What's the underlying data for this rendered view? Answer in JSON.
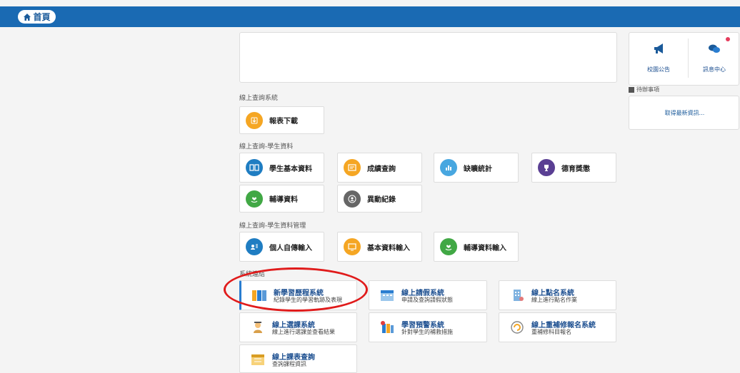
{
  "nav": {
    "home_label": "首頁"
  },
  "sections": {
    "query_system": "線上查詢系統",
    "student_data": "線上查詢-學生資料",
    "student_manage": "線上查詢-學生資料管理",
    "systems": "系統連結"
  },
  "query_items": [
    {
      "label": "報表下載",
      "icon": "download-icon"
    }
  ],
  "student_items": [
    {
      "label": "學生基本資料",
      "icon": "book-icon"
    },
    {
      "label": "成績查詢",
      "icon": "report-icon"
    },
    {
      "label": "缺曠統計",
      "icon": "bar-chart-icon"
    },
    {
      "label": "德育獎懲",
      "icon": "trophy-icon"
    },
    {
      "label": "輔導資料",
      "icon": "heart-hand-icon"
    },
    {
      "label": "異動紀錄",
      "icon": "person-circle-icon"
    }
  ],
  "manage_items": [
    {
      "label": "個人自傳輸入",
      "icon": "person-card-icon"
    },
    {
      "label": "基本資料輸入",
      "icon": "screen-icon"
    },
    {
      "label": "輔導資料輸入",
      "icon": "heart-hand-icon"
    }
  ],
  "systems": [
    {
      "title": "新學習歷程系統",
      "desc": "紀錄學生的學習軌跡及表現"
    },
    {
      "title": "線上請假系統",
      "desc": "申請及查詢請假狀態"
    },
    {
      "title": "線上點名系統",
      "desc": "線上進行點名作業"
    },
    {
      "title": "線上選課系統",
      "desc": "線上進行選課並查看結果"
    },
    {
      "title": "學習預警系統",
      "desc": "針對學生的補救措施"
    },
    {
      "title": "線上重補修報名系統",
      "desc": "重補修科目報名"
    },
    {
      "title": "線上課表查詢",
      "desc": "查詢課程資訊"
    }
  ],
  "right_panel": {
    "announce": "校園公告",
    "messages": "訊息中心",
    "todo_title": "待辦事項",
    "todo_link": "取得最新資訊..."
  },
  "colors": {
    "navbar": "#1a6ab3",
    "highlight": "#e01b1b",
    "link": "#1a4d8f"
  }
}
